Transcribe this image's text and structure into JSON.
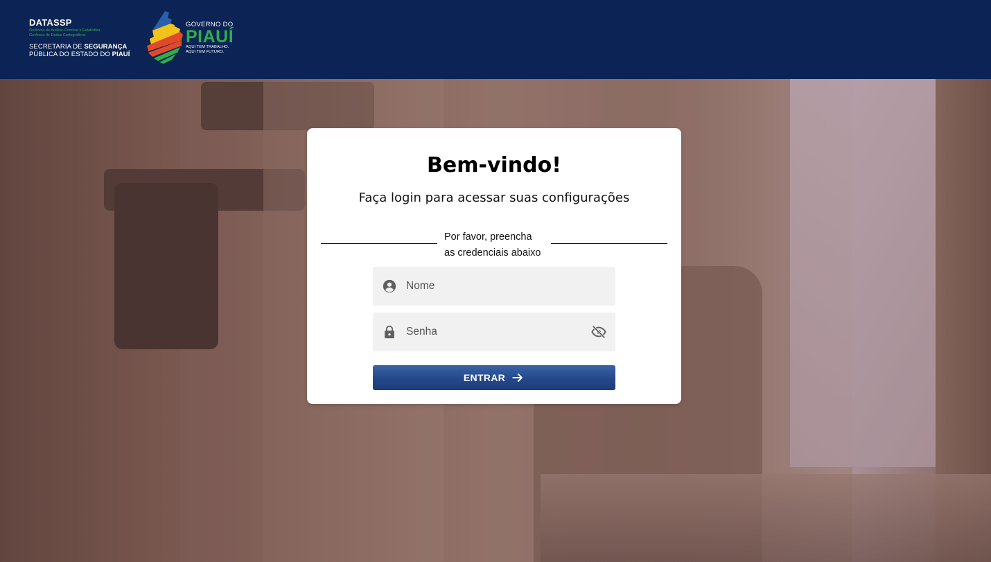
{
  "header": {
    "brand_name": "DATASSP",
    "brand_sub1": "Gerência de Análise Criminal e Estatística",
    "brand_sub2": "Gerência de Dados Cartográficos",
    "secretaria_line1_a": "SECRETARIA DE ",
    "secretaria_line1_b": "SEGURANÇA",
    "secretaria_line2_a": "PÚBLICA DO ESTADO DO ",
    "secretaria_line2_b": "PIAUÍ",
    "gov_line1": "GOVERNO DO",
    "gov_piaui": "PIAUÍ",
    "gov_tag1": "AQUI TEM TRABALHO.",
    "gov_tag2": "AQUI TEM FUTURO.",
    "background": "#0b2455"
  },
  "login": {
    "title": "Bem-vindo!",
    "subtitle": "Faça login para acessar suas configurações",
    "divider_line1": "Por favor, preencha",
    "divider_line2": "as credenciais abaixo",
    "name_placeholder": "Nome",
    "password_placeholder": "Senha",
    "submit_label": "ENTRAR"
  },
  "icons": {
    "user": "account-circle-icon",
    "lock": "lock-icon",
    "visibility": "eye-off-icon",
    "arrow": "arrow-right-icon",
    "map": "piaui-map-logo"
  },
  "colors": {
    "header": "#0b2455",
    "button": "#24488a",
    "accent_green": "#2fae4a",
    "card": "#ffffff"
  }
}
